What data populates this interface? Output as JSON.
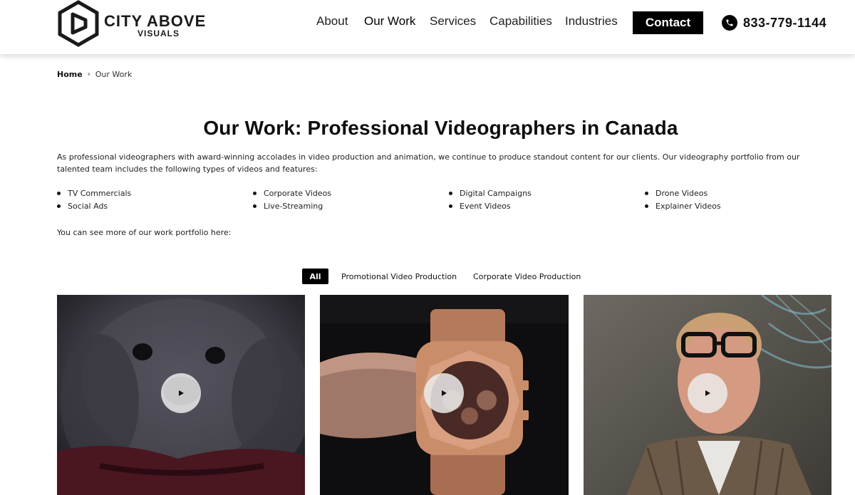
{
  "brand": {
    "name_line1": "CITY ABOVE",
    "name_line2": "VISUALS"
  },
  "nav": {
    "items": [
      {
        "label": "About",
        "active": false
      },
      {
        "label": "Our Work",
        "active": true
      },
      {
        "label": "Services",
        "active": false
      },
      {
        "label": "Capabilities",
        "active": false
      },
      {
        "label": "Industries",
        "active": false
      }
    ],
    "contact_label": "Contact",
    "phone": "833-779-1144"
  },
  "breadcrumb": {
    "home": "Home",
    "separator": "›",
    "current": "Our Work"
  },
  "main": {
    "title": "Our Work: Professional Videographers in Canada",
    "intro": "As professional videographers with award-winning accolades in video production and animation, we continue to produce standout content for our clients. Our videography portfolio from our talented team includes the following types of videos and features:",
    "features": [
      [
        "TV Commercials",
        "Social Ads"
      ],
      [
        "Corporate Videos",
        "Live-Streaming"
      ],
      [
        "Digital Campaigns",
        "Event Videos"
      ],
      [
        "Drone Videos",
        "Explainer Videos"
      ]
    ],
    "more_text": "You can see more of our work portfolio here:"
  },
  "filters": [
    {
      "label": "All",
      "active": true
    },
    {
      "label": "Promotional Video Production",
      "active": false
    },
    {
      "label": "Corporate Video Production",
      "active": false
    }
  ],
  "videos": [
    {
      "icon": "play-icon",
      "subject": "dog"
    },
    {
      "icon": "play-icon",
      "subject": "wristwatch"
    },
    {
      "icon": "play-icon",
      "subject": "man-with-glasses"
    }
  ],
  "colors": {
    "accent": "#000000",
    "text": "#111111",
    "header_border": "#e6e6e6"
  }
}
